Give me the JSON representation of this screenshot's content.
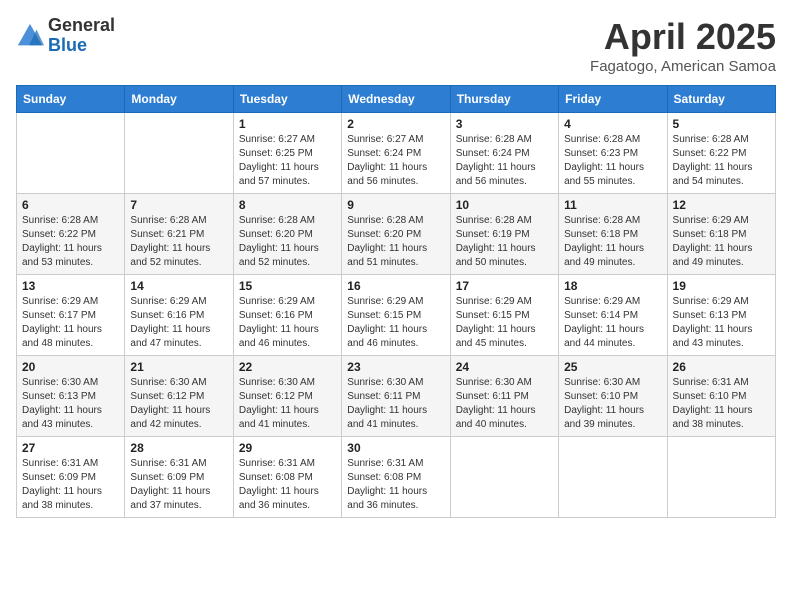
{
  "header": {
    "logo_general": "General",
    "logo_blue": "Blue",
    "month_title": "April 2025",
    "location": "Fagatogo, American Samoa"
  },
  "days_of_week": [
    "Sunday",
    "Monday",
    "Tuesday",
    "Wednesday",
    "Thursday",
    "Friday",
    "Saturday"
  ],
  "weeks": [
    [
      {
        "num": "",
        "info": ""
      },
      {
        "num": "",
        "info": ""
      },
      {
        "num": "1",
        "info": "Sunrise: 6:27 AM\nSunset: 6:25 PM\nDaylight: 11 hours\nand 57 minutes."
      },
      {
        "num": "2",
        "info": "Sunrise: 6:27 AM\nSunset: 6:24 PM\nDaylight: 11 hours\nand 56 minutes."
      },
      {
        "num": "3",
        "info": "Sunrise: 6:28 AM\nSunset: 6:24 PM\nDaylight: 11 hours\nand 56 minutes."
      },
      {
        "num": "4",
        "info": "Sunrise: 6:28 AM\nSunset: 6:23 PM\nDaylight: 11 hours\nand 55 minutes."
      },
      {
        "num": "5",
        "info": "Sunrise: 6:28 AM\nSunset: 6:22 PM\nDaylight: 11 hours\nand 54 minutes."
      }
    ],
    [
      {
        "num": "6",
        "info": "Sunrise: 6:28 AM\nSunset: 6:22 PM\nDaylight: 11 hours\nand 53 minutes."
      },
      {
        "num": "7",
        "info": "Sunrise: 6:28 AM\nSunset: 6:21 PM\nDaylight: 11 hours\nand 52 minutes."
      },
      {
        "num": "8",
        "info": "Sunrise: 6:28 AM\nSunset: 6:20 PM\nDaylight: 11 hours\nand 52 minutes."
      },
      {
        "num": "9",
        "info": "Sunrise: 6:28 AM\nSunset: 6:20 PM\nDaylight: 11 hours\nand 51 minutes."
      },
      {
        "num": "10",
        "info": "Sunrise: 6:28 AM\nSunset: 6:19 PM\nDaylight: 11 hours\nand 50 minutes."
      },
      {
        "num": "11",
        "info": "Sunrise: 6:28 AM\nSunset: 6:18 PM\nDaylight: 11 hours\nand 49 minutes."
      },
      {
        "num": "12",
        "info": "Sunrise: 6:29 AM\nSunset: 6:18 PM\nDaylight: 11 hours\nand 49 minutes."
      }
    ],
    [
      {
        "num": "13",
        "info": "Sunrise: 6:29 AM\nSunset: 6:17 PM\nDaylight: 11 hours\nand 48 minutes."
      },
      {
        "num": "14",
        "info": "Sunrise: 6:29 AM\nSunset: 6:16 PM\nDaylight: 11 hours\nand 47 minutes."
      },
      {
        "num": "15",
        "info": "Sunrise: 6:29 AM\nSunset: 6:16 PM\nDaylight: 11 hours\nand 46 minutes."
      },
      {
        "num": "16",
        "info": "Sunrise: 6:29 AM\nSunset: 6:15 PM\nDaylight: 11 hours\nand 46 minutes."
      },
      {
        "num": "17",
        "info": "Sunrise: 6:29 AM\nSunset: 6:15 PM\nDaylight: 11 hours\nand 45 minutes."
      },
      {
        "num": "18",
        "info": "Sunrise: 6:29 AM\nSunset: 6:14 PM\nDaylight: 11 hours\nand 44 minutes."
      },
      {
        "num": "19",
        "info": "Sunrise: 6:29 AM\nSunset: 6:13 PM\nDaylight: 11 hours\nand 43 minutes."
      }
    ],
    [
      {
        "num": "20",
        "info": "Sunrise: 6:30 AM\nSunset: 6:13 PM\nDaylight: 11 hours\nand 43 minutes."
      },
      {
        "num": "21",
        "info": "Sunrise: 6:30 AM\nSunset: 6:12 PM\nDaylight: 11 hours\nand 42 minutes."
      },
      {
        "num": "22",
        "info": "Sunrise: 6:30 AM\nSunset: 6:12 PM\nDaylight: 11 hours\nand 41 minutes."
      },
      {
        "num": "23",
        "info": "Sunrise: 6:30 AM\nSunset: 6:11 PM\nDaylight: 11 hours\nand 41 minutes."
      },
      {
        "num": "24",
        "info": "Sunrise: 6:30 AM\nSunset: 6:11 PM\nDaylight: 11 hours\nand 40 minutes."
      },
      {
        "num": "25",
        "info": "Sunrise: 6:30 AM\nSunset: 6:10 PM\nDaylight: 11 hours\nand 39 minutes."
      },
      {
        "num": "26",
        "info": "Sunrise: 6:31 AM\nSunset: 6:10 PM\nDaylight: 11 hours\nand 38 minutes."
      }
    ],
    [
      {
        "num": "27",
        "info": "Sunrise: 6:31 AM\nSunset: 6:09 PM\nDaylight: 11 hours\nand 38 minutes."
      },
      {
        "num": "28",
        "info": "Sunrise: 6:31 AM\nSunset: 6:09 PM\nDaylight: 11 hours\nand 37 minutes."
      },
      {
        "num": "29",
        "info": "Sunrise: 6:31 AM\nSunset: 6:08 PM\nDaylight: 11 hours\nand 36 minutes."
      },
      {
        "num": "30",
        "info": "Sunrise: 6:31 AM\nSunset: 6:08 PM\nDaylight: 11 hours\nand 36 minutes."
      },
      {
        "num": "",
        "info": ""
      },
      {
        "num": "",
        "info": ""
      },
      {
        "num": "",
        "info": ""
      }
    ]
  ]
}
